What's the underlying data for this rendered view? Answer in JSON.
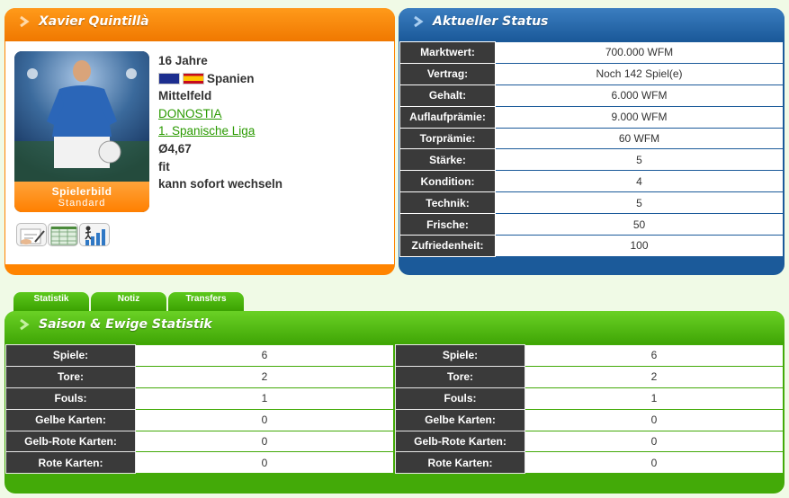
{
  "player": {
    "name": "Xavier Quintillà",
    "card_label_1": "Spielerbild",
    "card_label_2": "Standard",
    "age": "16 Jahre",
    "nation": "Spanien",
    "position": "Mittelfeld",
    "club": "DONOSTIA",
    "league": "1. Spanische Liga",
    "rating": "Ø4,67",
    "fitness": "fit",
    "transfer": "kann sofort wechseln",
    "icons": [
      "contract-icon",
      "notepad-icon",
      "stats-chart-icon"
    ]
  },
  "status": {
    "title": "Aktueller Status",
    "rows": [
      {
        "k": "Marktwert:",
        "v": "700.000 WFM"
      },
      {
        "k": "Vertrag:",
        "v": "Noch 142 Spiel(e)"
      },
      {
        "k": "Gehalt:",
        "v": "6.000 WFM"
      },
      {
        "k": "Auflaufprämie:",
        "v": "9.000 WFM"
      },
      {
        "k": "Torprämie:",
        "v": "60 WFM"
      },
      {
        "k": "Stärke:",
        "v": "5"
      },
      {
        "k": "Kondition:",
        "v": "4"
      },
      {
        "k": "Technik:",
        "v": "5"
      },
      {
        "k": "Frische:",
        "v": "50"
      },
      {
        "k": "Zufriedenheit:",
        "v": "100"
      }
    ]
  },
  "tabs": [
    "Statistik",
    "Notiz",
    "Transfers"
  ],
  "season": {
    "title": "Saison & Ewige Statistik",
    "left": [
      {
        "k": "Spiele:",
        "v": "6"
      },
      {
        "k": "Tore:",
        "v": "2"
      },
      {
        "k": "Fouls:",
        "v": "1"
      },
      {
        "k": "Gelbe Karten:",
        "v": "0"
      },
      {
        "k": "Gelb-Rote Karten:",
        "v": "0"
      },
      {
        "k": "Rote Karten:",
        "v": "0"
      }
    ],
    "right": [
      {
        "k": "Spiele:",
        "v": "6"
      },
      {
        "k": "Tore:",
        "v": "2"
      },
      {
        "k": "Fouls:",
        "v": "1"
      },
      {
        "k": "Gelbe Karten:",
        "v": "0"
      },
      {
        "k": "Gelb-Rote Karten:",
        "v": "0"
      },
      {
        "k": "Rote Karten:",
        "v": "0"
      }
    ]
  },
  "colors": {
    "orange": "#ff8400",
    "blue": "#1b5a9a",
    "green": "#43aa08",
    "link": "#2a9a00"
  }
}
